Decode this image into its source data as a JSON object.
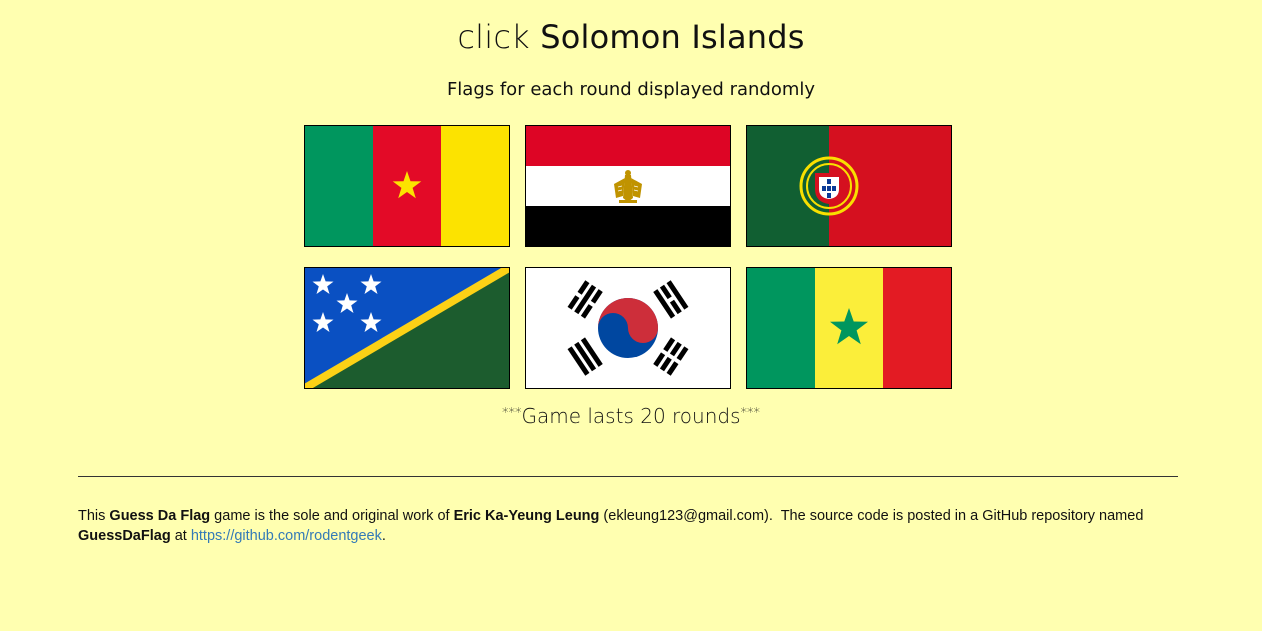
{
  "header": {
    "prompt_prefix": "click",
    "target_country": "Solomon Islands",
    "subtitle": "Flags for each round displayed randomly"
  },
  "flags": [
    {
      "country": "Cameroon",
      "icon": "cameroon-flag"
    },
    {
      "country": "Egypt",
      "icon": "egypt-flag"
    },
    {
      "country": "Portugal",
      "icon": "portugal-flag"
    },
    {
      "country": "Solomon Islands",
      "icon": "solomon-islands-flag"
    },
    {
      "country": "South Korea",
      "icon": "south-korea-flag"
    },
    {
      "country": "Senegal",
      "icon": "senegal-flag"
    }
  ],
  "note": {
    "stars_left": "***",
    "text": "Game lasts 20 rounds",
    "stars_right": "***"
  },
  "footer": {
    "t1": "This ",
    "game_name": "Guess Da Flag",
    "t2": " game is the sole and original work of ",
    "author": "Eric Ka-Yeung Leung",
    "t3": " (ekleung123@gmail.com).  The source code is posted in a GitHub repository named ",
    "repo": "GuessDaFlag",
    "t4": " at ",
    "link": "https://github.com/rodentgeek",
    "t5": "."
  },
  "colors": {
    "background": "#ffffb0",
    "link": "#337ab7"
  }
}
